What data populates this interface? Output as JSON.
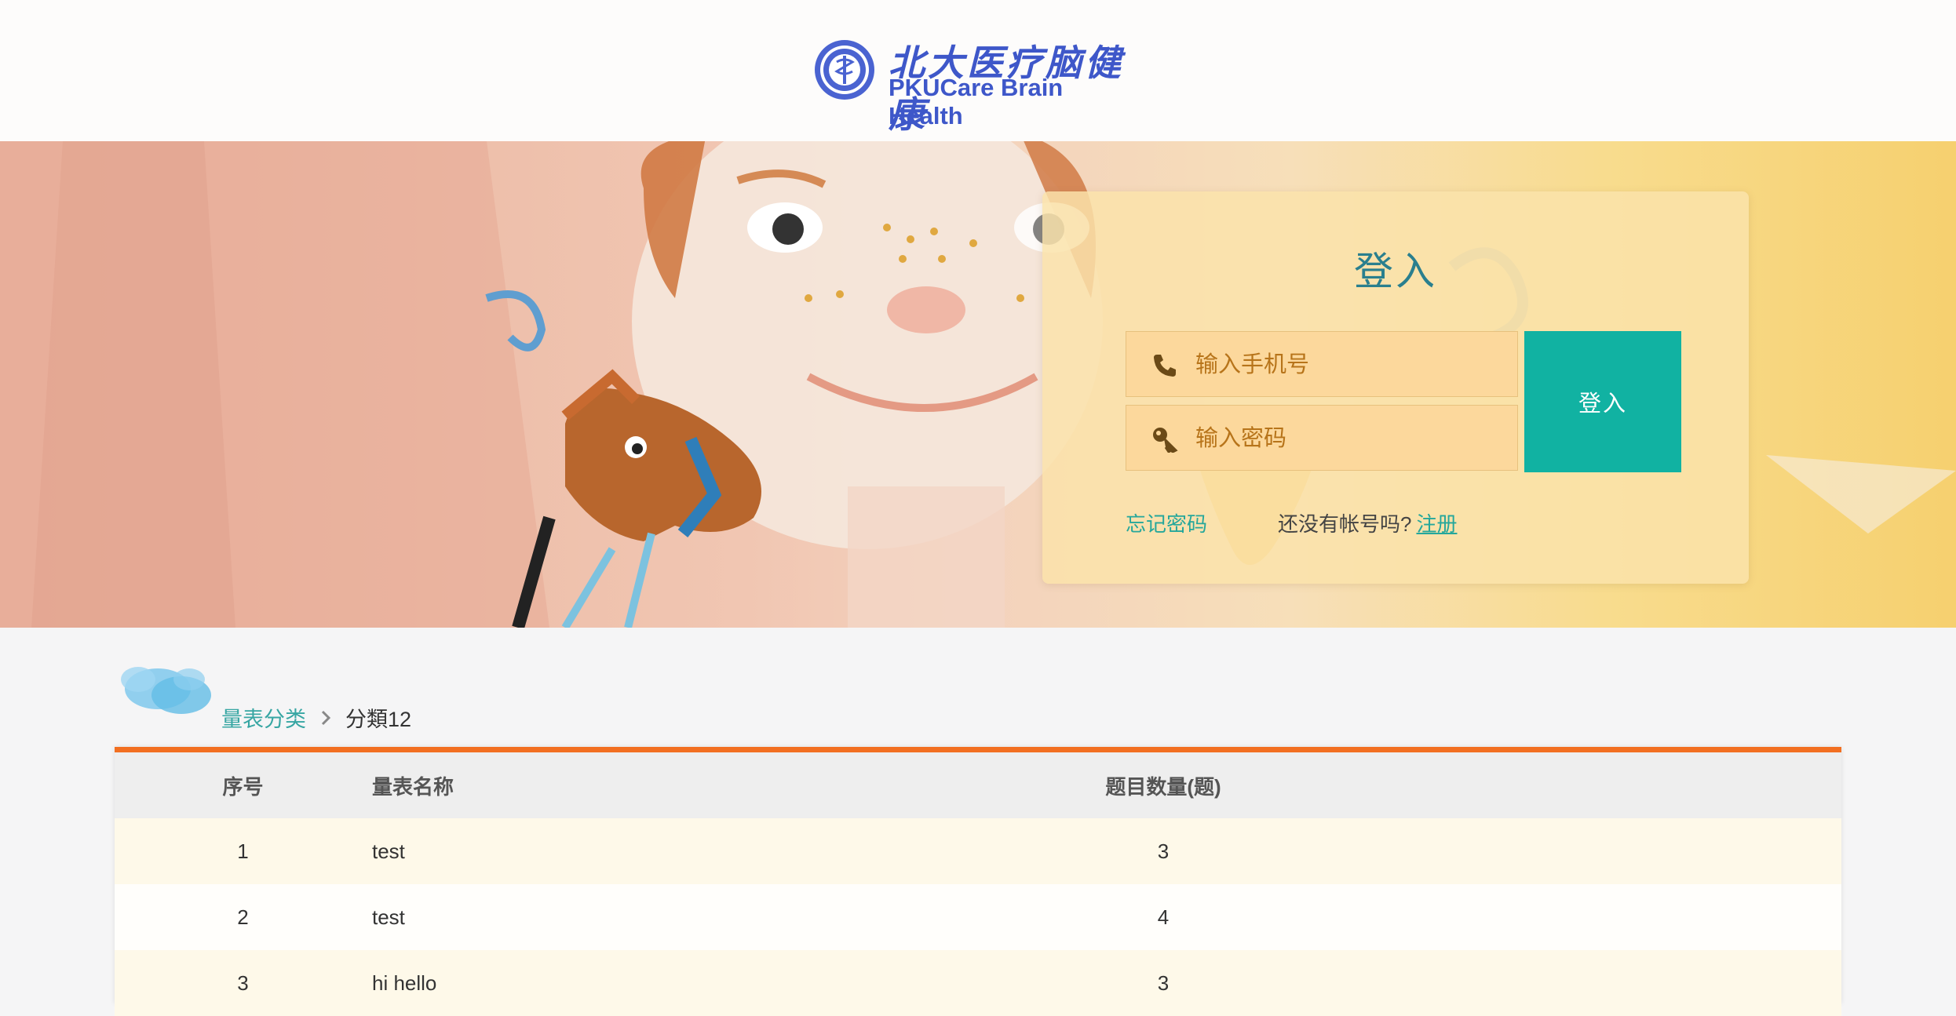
{
  "header": {
    "logo_cn": "北大医疗脑健康",
    "logo_en": "PKUCare Brain Health"
  },
  "login": {
    "title": "登入",
    "phone_placeholder": "输入手机号",
    "password_placeholder": "输入密码",
    "login_button": "登入",
    "forgot_password": "忘记密码",
    "no_account_text": "还没有帐号吗?",
    "register_link": "注册"
  },
  "breadcrumb": {
    "parent": "量表分类",
    "current": "分類12"
  },
  "table": {
    "headers": [
      "序号",
      "量表名称",
      "题目数量(题)"
    ],
    "rows": [
      {
        "index": "1",
        "name": "test",
        "count": "3"
      },
      {
        "index": "2",
        "name": "test",
        "count": "4"
      },
      {
        "index": "3",
        "name": "hi hello",
        "count": "3"
      }
    ]
  },
  "colors": {
    "accent_teal": "#11b2a2",
    "table_top_border": "#f26f21",
    "logo_blue": "#3e57c9"
  },
  "icons": [
    "seal-logo-icon",
    "phone-icon",
    "key-icon",
    "chevron-right-icon",
    "cloud-icon"
  ]
}
